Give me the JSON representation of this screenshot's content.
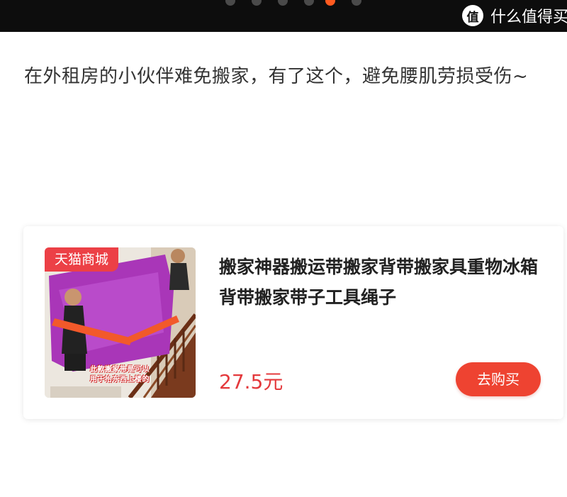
{
  "carousel": {
    "slide_count": 6,
    "active_index": 4
  },
  "watermark": {
    "logo_char": "值",
    "text": "什么值得买"
  },
  "description": "在外租房的小伙伴难免搬家，有了这个，避免腰肌劳损受伤~",
  "product": {
    "badge": "天猫商城",
    "image_caption_line1": "此款搬家带是可以",
    "image_caption_line2": "用于抬东西上楼的",
    "title": "搬家神器搬运带搬家背带搬家具重物冰箱背带搬家带子工具绳子",
    "price": "27.5元",
    "buy_label": "去购买",
    "buy_color": "#ee4331",
    "price_color": "#e4393c"
  }
}
